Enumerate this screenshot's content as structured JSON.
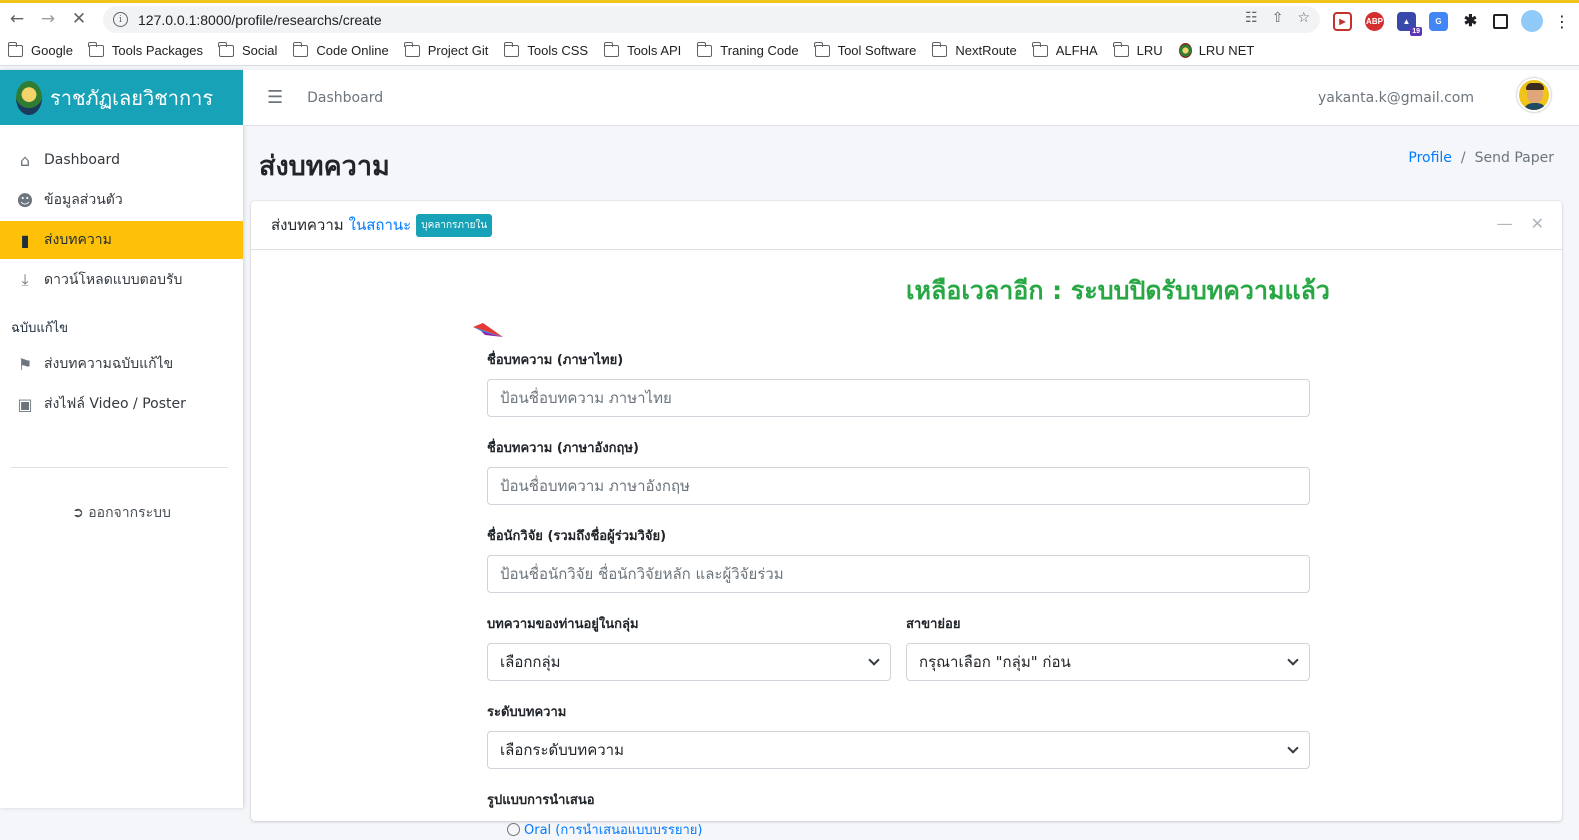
{
  "browser": {
    "url": "127.0.0.1:8000/profile/researchs/create",
    "bookmarks": [
      "Google",
      "Tools Packages",
      "Social",
      "Code Online",
      "Project Git",
      "Tools CSS",
      "Tools API",
      "Traning Code",
      "Tool Software",
      "NextRoute",
      "ALFHA",
      "LRU",
      "LRU NET"
    ],
    "ext_badge": "19"
  },
  "sidebar": {
    "brand": "ราชภัฏเลยวิชาการ",
    "items": [
      {
        "label": "Dashboard",
        "icon": "home-icon"
      },
      {
        "label": "ข้อมูลส่วนตัว",
        "icon": "user-circle-icon"
      },
      {
        "label": "ส่งบทความ",
        "icon": "book-icon",
        "active": true
      },
      {
        "label": "ดาวน์โหลดแบบตอบรับ",
        "icon": "download-icon"
      }
    ],
    "section_header": "ฉบับแก้ไข",
    "revision_items": [
      {
        "label": "ส่งบทความฉบับแก้ไข",
        "icon": "bookmark-icon"
      },
      {
        "label": "ส่งไฟล์ Video / Poster",
        "icon": "file-icon"
      }
    ],
    "logout": "ออกจากระบบ"
  },
  "topnav": {
    "dashboard_link": "Dashboard",
    "email": "yakanta.k@gmail.com"
  },
  "page": {
    "title": "ส่งบทความ",
    "breadcrumb": {
      "link": "Profile",
      "separator": "/",
      "current": "Send Paper"
    }
  },
  "card": {
    "header_prefix": "ส่งบทความ",
    "header_status": "ในสถานะ",
    "badge": "บุคลากรภายใน",
    "countdown": "เหลือเวลาอีก : ระบบปิดรับบทความแล้ว"
  },
  "form": {
    "title_th_label": "ชื่อบทความ (ภาษาไทย)",
    "title_th_placeholder": "ป้อนชื่อบทความ ภาษาไทย",
    "title_en_label": "ชื่อบทความ (ภาษาอังกฤษ)",
    "title_en_placeholder": "ป้อนชื่อบทความ ภาษาอังกฤษ",
    "researchers_label": "ชื่อนักวิจัย (รวมถึงชื่อผู้ร่วมวิจัย)",
    "researchers_placeholder": "ป้อนชื่อนักวิจัย ชื่อนักวิจัยหลัก และผู้วิจัยร่วม",
    "group_label": "บทความของท่านอยู่ในกลุ่ม",
    "group_value": "เลือกกลุ่ม",
    "subfield_label": "สาขาย่อย",
    "subfield_value": "กรุณาเลือก \"กลุ่ม\" ก่อน",
    "level_label": "ระดับบทความ",
    "level_value": "เลือกระดับบทความ",
    "presentation_label": "รูปแบบการนำเสนอ",
    "presentation_option": "Oral (การนำเสนอแบบบรรยาย)"
  }
}
